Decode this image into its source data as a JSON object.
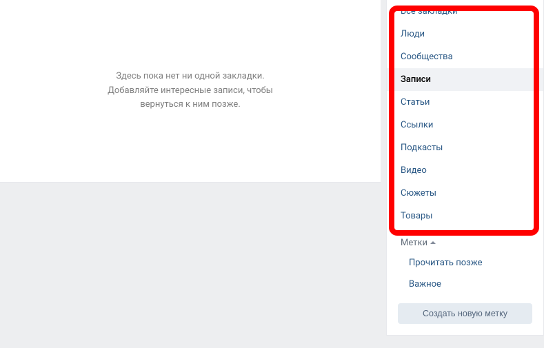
{
  "main": {
    "empty_line1": "Здесь пока нет ни одной закладки.",
    "empty_line2": "Добавляйте интересные записи, чтобы",
    "empty_line3": "вернуться к ним позже."
  },
  "sidebar": {
    "items": [
      {
        "label": "Все закладки",
        "active": false
      },
      {
        "label": "Люди",
        "active": false
      },
      {
        "label": "Сообщества",
        "active": false
      },
      {
        "label": "Записи",
        "active": true
      },
      {
        "label": "Статьи",
        "active": false
      },
      {
        "label": "Ссылки",
        "active": false
      },
      {
        "label": "Подкасты",
        "active": false
      },
      {
        "label": "Видео",
        "active": false
      },
      {
        "label": "Сюжеты",
        "active": false
      },
      {
        "label": "Товары",
        "active": false
      }
    ]
  },
  "labels": {
    "header": "Метки",
    "items": [
      {
        "label": "Прочитать позже"
      },
      {
        "label": "Важное"
      }
    ],
    "create_button": "Создать новую метку"
  }
}
